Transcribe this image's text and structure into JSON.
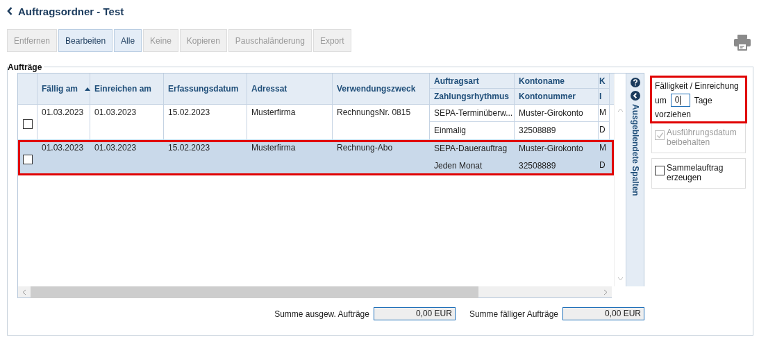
{
  "title": "Auftragsordner - Test",
  "toolbar": [
    {
      "label": "Entfernen",
      "disabled": true
    },
    {
      "label": "Bearbeiten",
      "disabled": false
    },
    {
      "label": "Alle",
      "disabled": false
    },
    {
      "label": "Keine",
      "disabled": true
    },
    {
      "label": "Kopieren",
      "disabled": true
    },
    {
      "label": "Pauschaländerung",
      "disabled": true
    },
    {
      "label": "Export",
      "disabled": true
    }
  ],
  "group_title": "Aufträge",
  "table": {
    "columns": [
      {
        "lines": [
          "Fällig am"
        ],
        "sorted": true
      },
      {
        "lines": [
          "Einreichen am"
        ]
      },
      {
        "lines": [
          "Erfassungsdatum"
        ]
      },
      {
        "lines": [
          "Adressat"
        ]
      },
      {
        "lines": [
          "Verwendungszweck"
        ]
      },
      {
        "lines": [
          "Auftragsart",
          "Zahlungsrhythmus"
        ]
      },
      {
        "lines": [
          "Kontoname",
          "Kontonummer"
        ]
      },
      {
        "lines": [
          "K",
          "I"
        ]
      }
    ],
    "rows": [
      {
        "checked": false,
        "selected": false,
        "highlighted": false,
        "cells": [
          [
            "01.03.2023"
          ],
          [
            "01.03.2023"
          ],
          [
            "15.02.2023"
          ],
          [
            "Musterfirma"
          ],
          [
            "RechnungsNr. 0815"
          ],
          [
            "SEPA-Terminüberw...",
            "Einmalig"
          ],
          [
            "Muster-Girokonto",
            "32508889"
          ],
          [
            "M",
            "D"
          ]
        ]
      },
      {
        "checked": false,
        "selected": true,
        "highlighted": true,
        "cells": [
          [
            "01.03.2023"
          ],
          [
            "01.03.2023"
          ],
          [
            "15.02.2023"
          ],
          [
            "Musterfirma"
          ],
          [
            "Rechnung-Abo"
          ],
          [
            "SEPA-Dauerauftrag",
            "Jeden Monat"
          ],
          [
            "Muster-Girokonto",
            "32508889"
          ],
          [
            "M",
            "D"
          ]
        ]
      }
    ]
  },
  "hidden_columns_label": "Ausgeblendete Spalten",
  "sums": [
    {
      "label": "Summe ausgew. Aufträge",
      "value": "0,00 EUR"
    },
    {
      "label": "Summe fälliger Aufträge",
      "value": "0,00 EUR"
    }
  ],
  "advance": {
    "title": "Fälligkeit / Einreichung",
    "prefix": "um",
    "value": "0",
    "unit": "Tage",
    "suffix": "vorziehen",
    "highlighted": true
  },
  "options": [
    {
      "label": "Ausführungsdatum beibehalten",
      "checked": true,
      "disabled": true
    },
    {
      "label": "Sammelauftrag erzeugen",
      "checked": false,
      "disabled": false
    }
  ]
}
